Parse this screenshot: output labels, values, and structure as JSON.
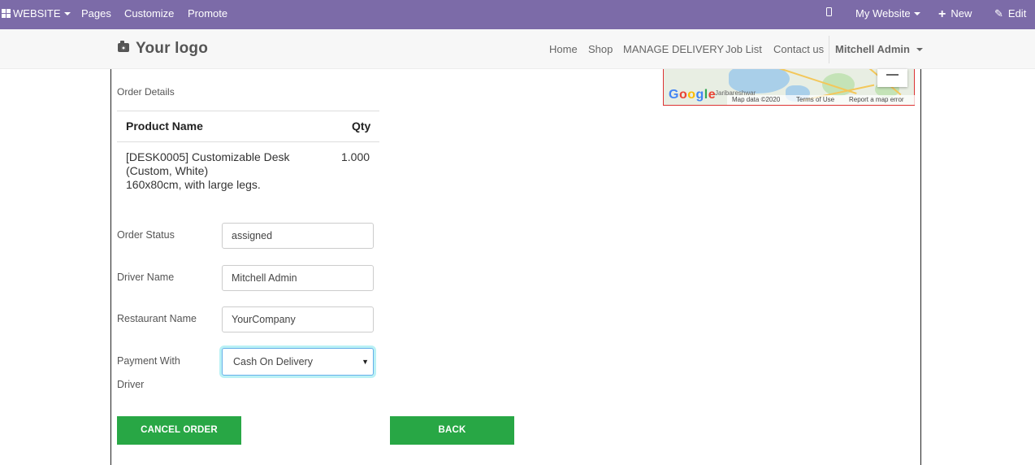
{
  "adminbar": {
    "website_label": "WEBSITE",
    "pages_label": "Pages",
    "customize_label": "Customize",
    "promote_label": "Promote",
    "my_website_label": "My Website",
    "new_label": "New",
    "edit_label": "Edit",
    "color": "#7c6ba8"
  },
  "header": {
    "logo_text": "Your logo",
    "nav": [
      "Home",
      "Shop",
      "MANAGE DELIVERY",
      "Job List",
      "Contact us"
    ],
    "user": "Mitchell Admin"
  },
  "order": {
    "section_title": "Order Details",
    "columns": {
      "name": "Product Name",
      "qty": "Qty"
    },
    "lines": [
      {
        "name_line1": "[DESK0005] Customizable Desk",
        "name_line2": "(Custom, White)",
        "name_line3": "160x80cm, with large legs.",
        "qty": "1.000"
      }
    ]
  },
  "form": {
    "order_status_label": "Order Status",
    "order_status_value": "assigned",
    "driver_name_label": "Driver Name",
    "driver_name_value": "Mitchell Admin",
    "restaurant_name_label": "Restaurant Name",
    "restaurant_name_value": "YourCompany",
    "payment_label_line1": "Payment With",
    "payment_label_line2": "Driver",
    "payment_value": "Cash On Delivery"
  },
  "buttons": {
    "cancel_label": "CANCEL ORDER",
    "back_label": "BACK",
    "color": "#28a745"
  },
  "map": {
    "google_text": "Google",
    "map_data": "Map data ©2020",
    "terms": "Terms of Use",
    "report": "Report a map error",
    "place_fragment": "Jaribareshwar"
  }
}
